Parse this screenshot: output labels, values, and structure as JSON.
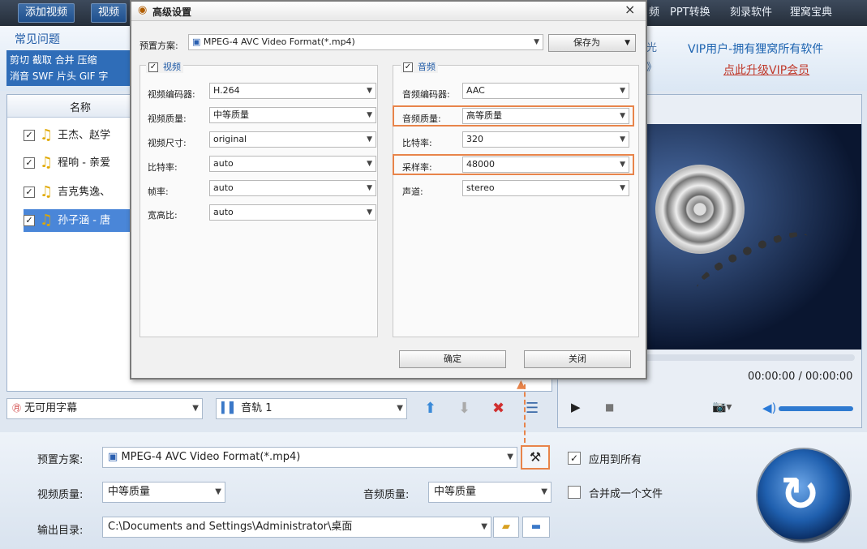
{
  "toolbar": {
    "add_video": "添加视频",
    "video_tab": "视频",
    "link_video": "频",
    "ppt": "PPT转换",
    "burn": "刻录软件",
    "collection": "狸窝宝典"
  },
  "banner": {
    "faq": "常见问题",
    "tags_line1": "剪切 截取 合并 压缩",
    "tags_line2": "消音 SWF 片头 GIF 字",
    "side1": "光",
    "side2": "》",
    "vip_text": "VIP用户-拥有狸窝所有软件",
    "vip_upgrade": "点此升级VIP会员"
  },
  "filelist": {
    "col_name": "名称",
    "rows": [
      {
        "name": "王杰、赵学",
        "checked": true,
        "selected": false
      },
      {
        "name": "程响 - 亲爱",
        "checked": true,
        "selected": false
      },
      {
        "name": "吉克隽逸、",
        "checked": true,
        "selected": false
      },
      {
        "name": "孙子涵 - 唐",
        "checked": true,
        "selected": true
      }
    ]
  },
  "preview": {
    "time": "00:00:00 / 00:00:00"
  },
  "controls": {
    "subtitle": "无可用字幕",
    "audio_track": "音轨 1"
  },
  "bottom": {
    "preset_label": "预置方案:",
    "preset_value": "MPEG-4 AVC Video Format(*.mp4)",
    "vq_label": "视频质量:",
    "vq_value": "中等质量",
    "aq_label": "音频质量:",
    "aq_value": "中等质量",
    "out_label": "输出目录:",
    "out_value": "C:\\Documents and Settings\\Administrator\\桌面",
    "apply_all": "应用到所有",
    "merge": "合并成一个文件"
  },
  "dialog": {
    "title": "高级设置",
    "close": "×",
    "preset_label": "预置方案:",
    "preset_value": "MPEG-4 AVC Video Format(*.mp4)",
    "save_as": "保存为",
    "video_group": "视频",
    "audio_group": "音频",
    "video_fields": [
      {
        "label": "视频编码器:",
        "value": "H.264"
      },
      {
        "label": "视频质量:",
        "value": "中等质量"
      },
      {
        "label": "视频尺寸:",
        "value": "original"
      },
      {
        "label": "比特率:",
        "value": "auto"
      },
      {
        "label": "帧率:",
        "value": "auto"
      },
      {
        "label": "宽高比:",
        "value": "auto"
      }
    ],
    "audio_fields": [
      {
        "label": "音频编码器:",
        "value": "AAC"
      },
      {
        "label": "音频质量:",
        "value": "高等质量"
      },
      {
        "label": "比特率:",
        "value": "320"
      },
      {
        "label": "采样率:",
        "value": "48000"
      },
      {
        "label": "声道:",
        "value": "stereo"
      }
    ],
    "ok": "确定",
    "cancel": "关闭"
  },
  "colors": {
    "highlight": "#e8844a",
    "accent": "#1f5aa6"
  }
}
